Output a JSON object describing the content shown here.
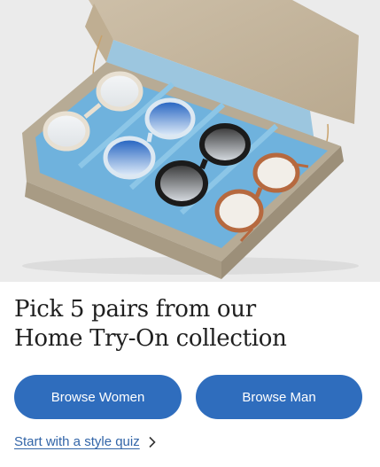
{
  "hero": {
    "image_subject": "glasses-box-icon"
  },
  "headline": {
    "line1": "Pick 5 pairs from our",
    "line2": "Home Try-On collection"
  },
  "buttons": {
    "women_label": "Browse Women",
    "man_label": "Browse Man"
  },
  "quiz_link": {
    "label": "Start with a style quiz",
    "icon": "chevron-right-icon"
  },
  "colors": {
    "accent": "#2f6dbd",
    "link": "#3265a8",
    "headline": "#1f1f1f",
    "hero_background": "#ebebeb"
  }
}
